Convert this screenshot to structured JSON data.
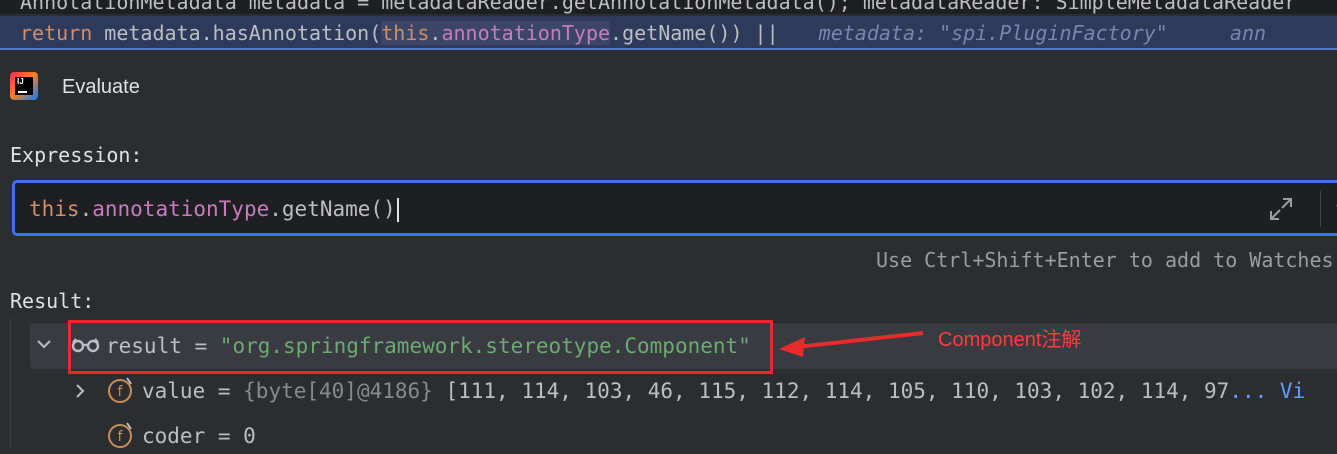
{
  "editor": {
    "line1": "AnnotationMetadata metadata = metadataReader.getAnnotationMetadata();   metadataReader: SimpleMetadataReader",
    "line2": {
      "kw_return": "return",
      "part1": " metadata.hasAnnotation(",
      "this_kw": "this",
      "dot1": ".",
      "field": "annotationType",
      "part2": ".getName()) ||",
      "hint": "metadata: \"spi.PluginFactory\"",
      "hint2": "ann"
    }
  },
  "dialog": {
    "title": "Evaluate",
    "expression_label": "Expression:",
    "expression": {
      "this_kw": "this",
      "dot": ".",
      "field": "annotationType",
      "rest": ".getName()"
    },
    "hint": "Use Ctrl+Shift+Enter to add to Watches",
    "result_label": "Result:"
  },
  "tree": {
    "row1": {
      "name": "result",
      "eq": " = ",
      "value": "\"org.springframework.stereotype.Component\""
    },
    "row2": {
      "icon_letter": "f",
      "name": "value",
      "eq": " = ",
      "type": "{byte[40]@4186}",
      "values": " [111, 114, 103, 46, 115, 112, 114, 105, 110, 103, 102, 114, 97",
      "more": "... ",
      "view": "Vi"
    },
    "row3": {
      "icon_letter": "f",
      "name": "coder",
      "eq": " = ",
      "value": "0"
    }
  },
  "annotation": {
    "text": "Component注解",
    "color": "#e52b2b"
  },
  "colors": {
    "accent": "#3574f0",
    "background": "#2b2d30",
    "string": "#6aab73",
    "number": "#2aacb8"
  },
  "icons": [
    "intellij-logo-icon",
    "expand-icon",
    "chevron-down-icon",
    "glasses-icon",
    "field-icon",
    "chevron-right-icon"
  ]
}
